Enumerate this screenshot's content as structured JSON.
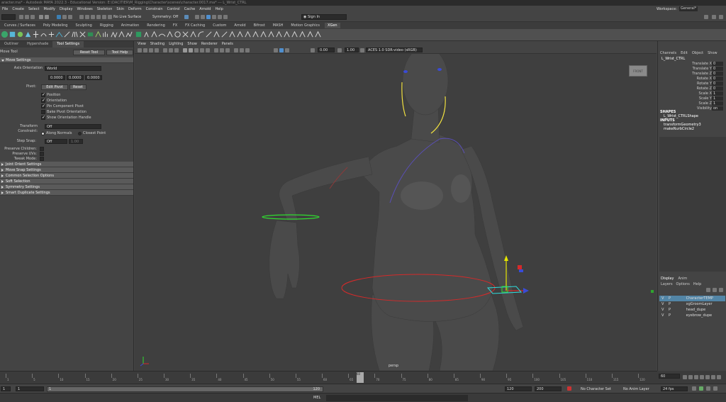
{
  "window": {
    "title": "aracter.ma* - Autodesk MAYA 2022.3 - Educational Version: E:\\DACITIER\\M_Rigging\\Character\\scenes\\character.0017.ma* --- L_Wrist_CTRL"
  },
  "menubar": {
    "items": [
      "File",
      "Create",
      "Select",
      "Modify",
      "Display",
      "Windows",
      "Skeleton",
      "Skin",
      "Deform",
      "Constrain",
      "Control",
      "Cache",
      "Arnold",
      "Help"
    ],
    "workspace_label": "Workspace:",
    "workspace_value": "General*"
  },
  "statusline": {
    "menuset": "Rigging",
    "no_live_surface": "No Live Surface",
    "symmetry": "Symmetry: Off",
    "sign_in": "Sign In"
  },
  "shelf_tabs": [
    "Curves / Surfaces",
    "Poly Modeling",
    "Sculpting",
    "Rigging",
    "Animation",
    "Rendering",
    "FX",
    "FX Caching",
    "Custom",
    "Arnold",
    "Bifrost",
    "MASH",
    "Motion Graphics",
    "XGen"
  ],
  "shelf_active": "XGen",
  "left_panel": {
    "tabs": [
      "Outliner",
      "Hypershade",
      "Tool Settings"
    ],
    "tool_name": "Move Tool",
    "reset_tool": "Reset Tool",
    "tool_help": "Tool Help",
    "sections": {
      "move_settings": "Move Settings",
      "joint_orient": "Joint Orient Settings",
      "move_snap": "Move Snap Settings",
      "common_selection": "Common Selection Options",
      "soft_selection": "Soft Selection",
      "symmetry_settings": "Symmetry Settings",
      "smart_duplicate": "Smart Duplicate Settings"
    },
    "axis_orientation_label": "Axis Orientation",
    "axis_orientation_value": "World",
    "xyz": [
      "0.0000",
      "0.0000",
      "0.0000"
    ],
    "pivot_label": "Pivot:",
    "edit_pivot": "Edit Pivot",
    "reset_pivot": "Reset",
    "checks": [
      {
        "label": "Position",
        "on": true
      },
      {
        "label": "Orientation",
        "on": true
      },
      {
        "label": "Pin Component Pivot",
        "on": true
      },
      {
        "label": "Bake Pivot Orientation",
        "on": false
      },
      {
        "label": "Show Orientation Handle",
        "on": true
      }
    ],
    "transform_constraint_label": "Transform Constraint:",
    "transform_constraint_value": "Off",
    "along_normals": "Along Normals",
    "closest_point": "Closest Point",
    "step_snap_label": "Step Snap:",
    "step_snap_value": "Off",
    "step_snap_num": "1.00",
    "preserve_children": "Preserve Children:",
    "preserve_uvs": "Preserve UVs:",
    "tweak_mode": "Tweak Mode:"
  },
  "viewport": {
    "menu": [
      "View",
      "Shading",
      "Lighting",
      "Show",
      "Renderer",
      "Panels"
    ],
    "field_a": "0.00",
    "field_b": "1.00",
    "color_space": "ACES 1.0 SDR-video (sRGB)",
    "camera_label": "persp",
    "viewcube_label": "FRONT"
  },
  "channel_box": {
    "menu": [
      "Channels",
      "Edit",
      "Object",
      "Show"
    ],
    "object_name": "L_Wrist_CTRL",
    "channels": [
      {
        "name": "Translate X",
        "value": "0"
      },
      {
        "name": "Translate Y",
        "value": "0"
      },
      {
        "name": "Translate Z",
        "value": "0"
      },
      {
        "name": "Rotate X",
        "value": "0"
      },
      {
        "name": "Rotate Y",
        "value": "0"
      },
      {
        "name": "Rotate Z",
        "value": "0"
      },
      {
        "name": "Scale X",
        "value": "1"
      },
      {
        "name": "Scale Y",
        "value": "1"
      },
      {
        "name": "Scale Z",
        "value": "1"
      },
      {
        "name": "Visibility",
        "value": "on"
      }
    ],
    "shapes_label": "SHAPES",
    "shape_name": "L_Wrist_CTRLShape",
    "inputs_label": "INPUTS",
    "inputs": [
      "transformGeometry3",
      "makeNurbCircle2"
    ]
  },
  "layer_editor": {
    "tabs": [
      "Display",
      "Anim"
    ],
    "menu": [
      "Layers",
      "Options",
      "Help"
    ],
    "layers": [
      {
        "v": "V",
        "p": "P",
        "name": "CharacterTEMP",
        "selected": true
      },
      {
        "v": "V",
        "p": "P",
        "name": "xgGroomLayer",
        "selected": false
      },
      {
        "v": "V",
        "p": "P",
        "name": "head_dupe",
        "selected": false
      },
      {
        "v": "V",
        "p": "P",
        "name": "eyebrow_dupe",
        "selected": false
      }
    ]
  },
  "timeline": {
    "ticks": [
      "1",
      "5",
      "10",
      "15",
      "20",
      "25",
      "30",
      "35",
      "40",
      "45",
      "50",
      "55",
      "60",
      "65",
      "70",
      "75",
      "80",
      "85",
      "90",
      "95",
      "100",
      "105",
      "110",
      "115",
      "120"
    ],
    "current_frame": "60",
    "current_frame_field": "60"
  },
  "range": {
    "start": "1",
    "start_inner": "1",
    "range_start_num": "1",
    "range_end_num": "120",
    "end_inner": "120",
    "end": "200",
    "character_set": "No Character Set",
    "anim_layer": "No Anim Layer",
    "fps": "24 fps"
  },
  "command_line": {
    "lang": "MEL"
  }
}
